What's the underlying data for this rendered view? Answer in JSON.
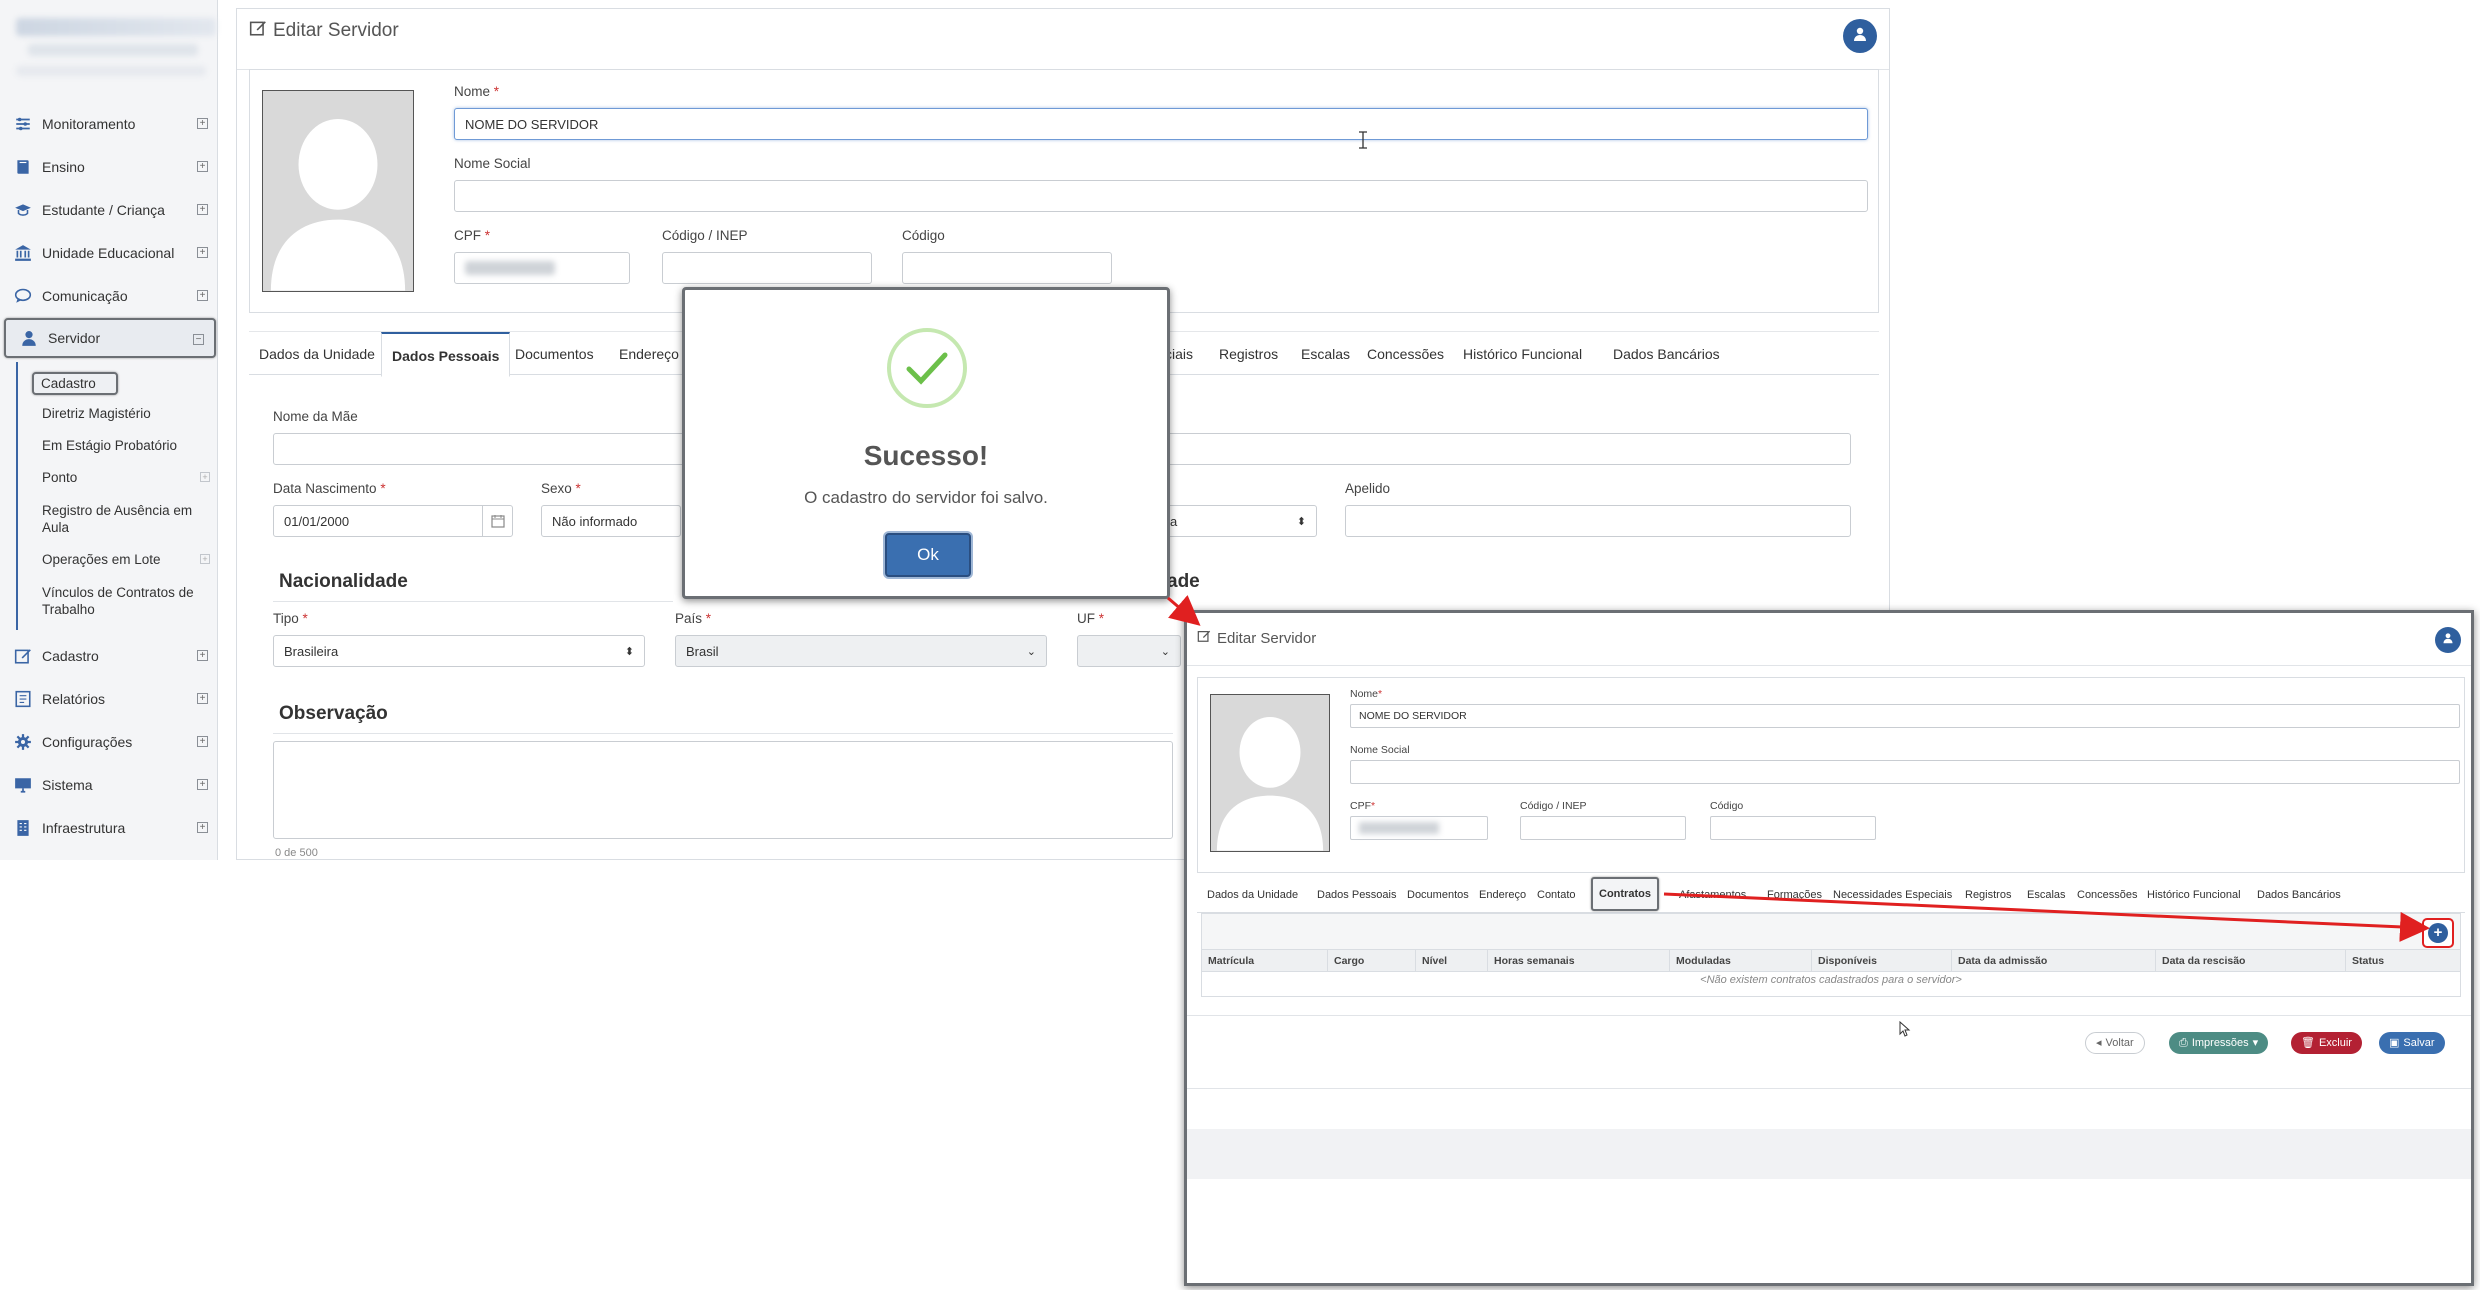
{
  "sidebar": {
    "items": [
      {
        "label": "Monitoramento",
        "icon": "sliders-icon"
      },
      {
        "label": "Ensino",
        "icon": "book-icon"
      },
      {
        "label": "Estudante / Criança",
        "icon": "graduation-cap-icon"
      },
      {
        "label": "Unidade Educacional",
        "icon": "building-columns-icon"
      },
      {
        "label": "Comunicação",
        "icon": "speech-bubble-icon"
      },
      {
        "label": "Servidor",
        "icon": "user-icon"
      },
      {
        "label": "Cadastro",
        "icon": "edit-icon"
      },
      {
        "label": "Relatórios",
        "icon": "report-icon"
      },
      {
        "label": "Configurações",
        "icon": "gear-icon"
      },
      {
        "label": "Sistema",
        "icon": "monitor-icon"
      },
      {
        "label": "Infraestrutura",
        "icon": "building-icon"
      }
    ],
    "servidor_sub": [
      "Cadastro",
      "Diretriz Magistério",
      "Em Estágio Probatório",
      "Ponto",
      "Registro de Ausência em Aula",
      "Operações em Lote",
      "Vínculos de Contratos de Trabalho"
    ]
  },
  "page": {
    "title": "Editar Servidor",
    "nome_label": "Nome",
    "nome_value": "NOME DO SERVIDOR",
    "nome_social_label": "Nome Social",
    "cpf_label": "CPF",
    "codigo_inep_label": "Código / INEP",
    "codigo_label": "Código",
    "tabs": [
      "Dados da Unidade",
      "Dados Pessoais",
      "Documentos",
      "Endereço",
      "ciais",
      "Registros",
      "Escalas",
      "Concessões",
      "Histórico Funcional",
      "Dados Bancários"
    ],
    "nome_mae_label": "Nome da Mãe",
    "data_nasc_label": "Data Nascimento",
    "data_nasc_value": "01/01/2000",
    "sexo_label": "Sexo",
    "sexo_value": "Não informado",
    "hidden_select_value": "a",
    "apelido_label": "Apelido",
    "nacionalidade_title": "Nacionalidade",
    "partial_section_title": "ade",
    "tipo_label": "Tipo",
    "tipo_value": "Brasileira",
    "pais_label": "País",
    "pais_value": "Brasil",
    "uf_label": "UF",
    "observacao_title": "Observação",
    "obs_counter": "0 de 500"
  },
  "modal": {
    "title": "Sucesso!",
    "message": "O cadastro do servidor foi salvo.",
    "ok_label": "Ok"
  },
  "inset": {
    "title": "Editar Servidor",
    "nome_label": "Nome",
    "nome_value": "NOME DO SERVIDOR",
    "nome_social_label": "Nome Social",
    "cpf_label": "CPF",
    "codigo_inep_label": "Código / INEP",
    "codigo_label": "Código",
    "tabs": [
      "Dados da Unidade",
      "Dados Pessoais",
      "Documentos",
      "Endereço",
      "Contato",
      "Contratos",
      "Afastamentos",
      "Formações",
      "Necessidades Especiais",
      "Registros",
      "Escalas",
      "Concessões",
      "Histórico Funcional",
      "Dados Bancários"
    ],
    "columns": [
      "Matrícula",
      "Cargo",
      "Nível",
      "Horas semanais",
      "Moduladas",
      "Disponíveis",
      "Data da admissão",
      "Data da rescisão",
      "Status"
    ],
    "empty_message": "<Não existem contratos cadastrados para o servidor>",
    "add_label": "+",
    "buttons": {
      "back": "Voltar",
      "print": "Impressões",
      "delete": "Excluir",
      "save": "Salvar"
    }
  },
  "colors": {
    "primary": "#2f5f9e",
    "success_check": "#6cc04a",
    "danger": "#b32133",
    "teal": "#4d8c84",
    "annotation_red": "#e02020"
  }
}
